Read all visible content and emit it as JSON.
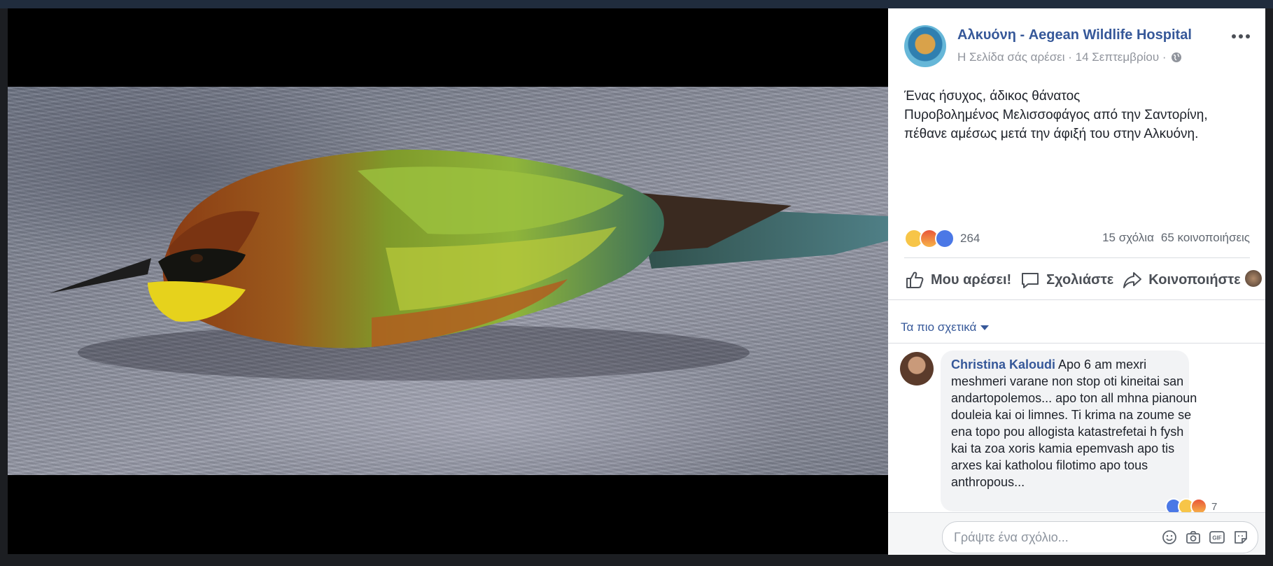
{
  "post": {
    "page_name": "Αλκυόνη - Aegean Wildlife Hospital",
    "meta_text": "Η Σελίδα σάς αρέσει · 14 Σεπτεμβρίου ·",
    "text_lines": [
      "Ένας ήσυχος, άδικος θάνατος",
      "Πυροβολημένος Μελισσοφάγος από την Σαντορίνη,",
      "πέθανε αμέσως μετά την άφιξή του στην Αλκυόνη."
    ]
  },
  "stats": {
    "reaction_count": "264",
    "comments": "15 σχόλια",
    "shares": "65 κοινοποιήσεις"
  },
  "actions": {
    "like": "Μου αρέσει!",
    "comment": "Σχολιάστε",
    "share": "Κοινοποιήστε"
  },
  "comments_sort": "Τα πιο σχετικά",
  "comment": {
    "author": "Christina Kaloudi",
    "lines": [
      " Apo 6 am mexri",
      "meshmeri varane non stop oti kineitai san",
      "andartopolemos... apo ton all mhna pianoun",
      "douleia kai oi limnes. Ti krima na zoume se",
      "ena topo pou allogista katastrefetai h fysh",
      "kai ta zoa xoris kamia epemvash apo tis",
      "arxes kai katholou filotimo apo tous",
      "anthropous..."
    ],
    "reaction_count": "7"
  },
  "composer": {
    "placeholder": "Γράψτε ένα σχόλιο..."
  },
  "icons": [
    "globe-icon",
    "more-icon",
    "like-icon",
    "comment-icon",
    "share-icon",
    "emoji-icon",
    "camera-icon",
    "gif-icon",
    "sticker-icon",
    "caret-down-icon"
  ],
  "colors": {
    "link": "#365899",
    "secondary_text": "#90949c",
    "like_blue": "#4b78e6"
  }
}
